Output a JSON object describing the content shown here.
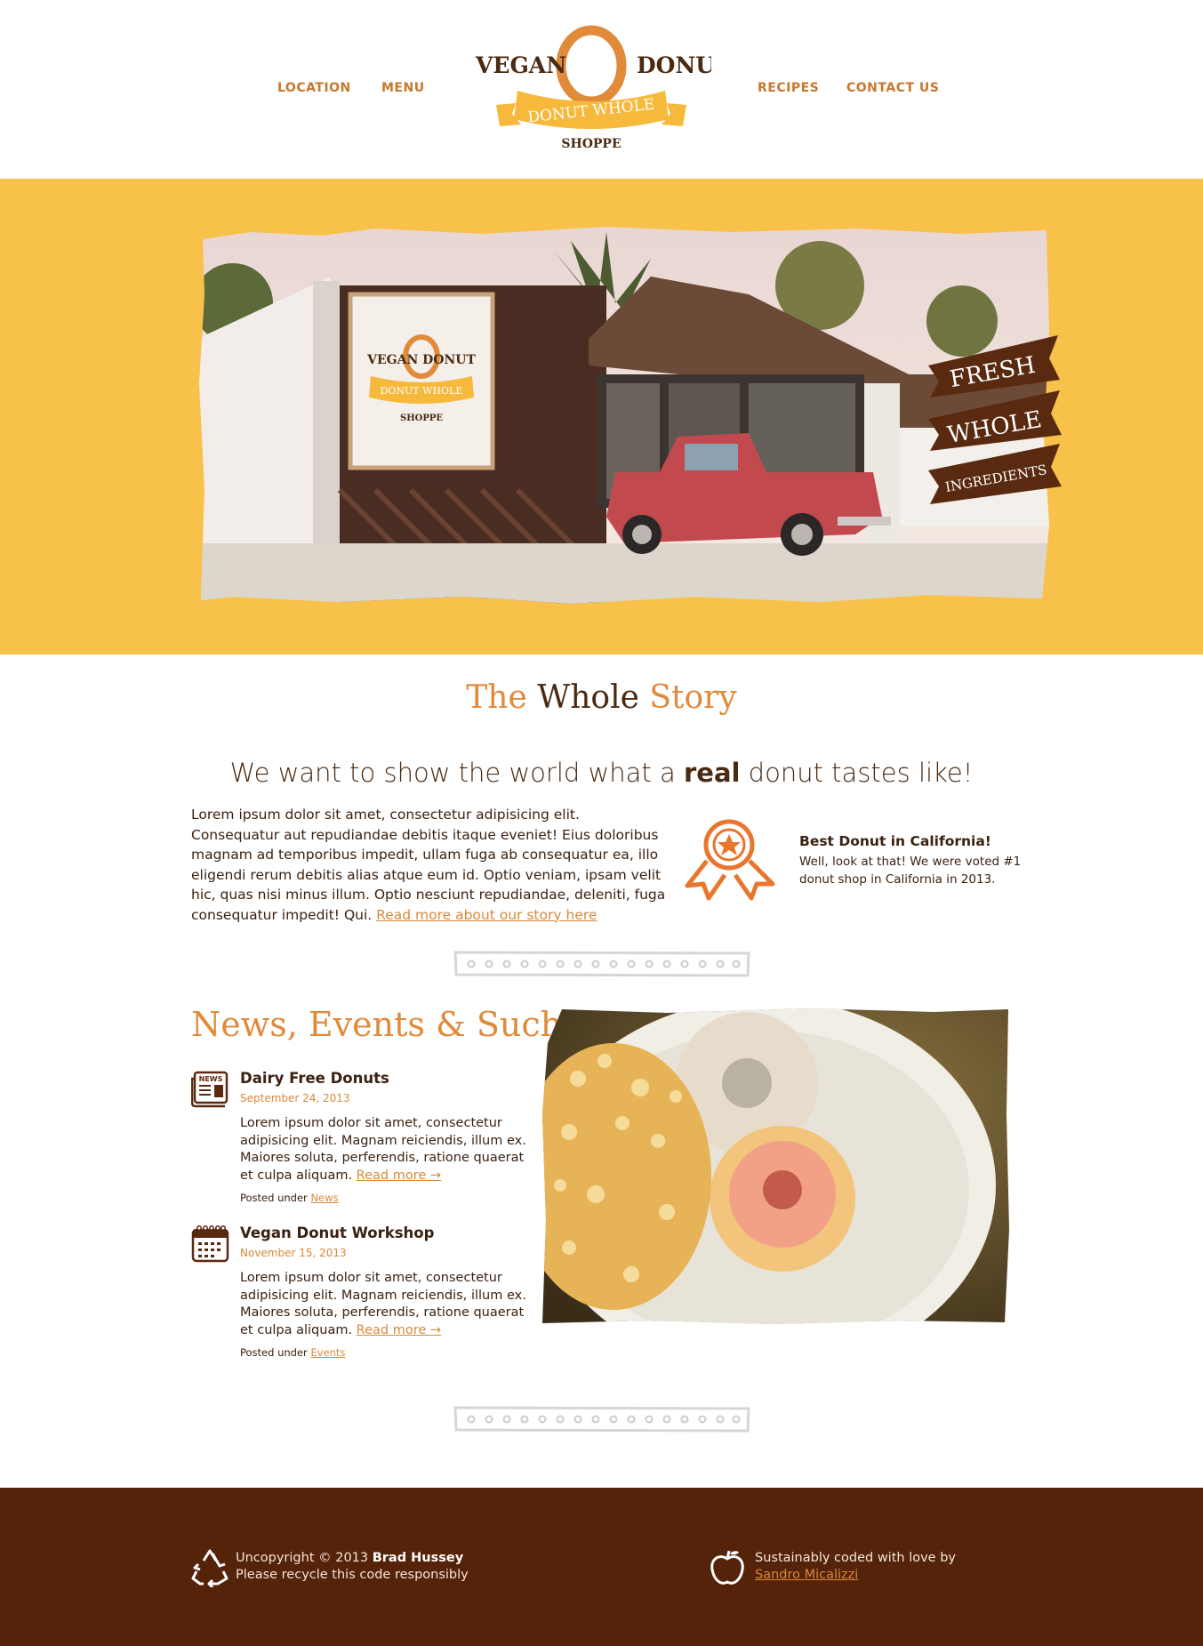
{
  "nav": {
    "location": "LOCATION",
    "menu": "MENU",
    "recipes": "RECIPES",
    "contact": "CONTACT US"
  },
  "logo": {
    "word1": "VEGAN",
    "word2": "DONUT",
    "banner": "DONUT WHOLE",
    "sub": "SHOPPE"
  },
  "hero": {
    "ribbon1": "FRESH",
    "ribbon2": "WHOLE",
    "ribbon3": "INGREDIENTS",
    "store_sign": "VEGAN DONUT",
    "store_banner": "DONUT WHOLE",
    "store_sub": "SHOPPE"
  },
  "story": {
    "title_part1": "The",
    "title_part2": "Whole",
    "title_part3": "Story",
    "tagline_pre": "We want to show the world what a ",
    "tagline_bold": "real",
    "tagline_post": " donut tastes like!",
    "body": "Lorem ipsum dolor sit amet, consectetur adipisicing elit. Consequatur aut repudiandae debitis itaque eveniet! Eius doloribus magnam ad temporibus impedit, ullam fuga ab consequatur ea, illo eligendi rerum debitis alias atque eum id. Optio veniam, ipsam velit hic, quas nisi minus illum. Optio nesciunt repudiandae, deleniti, fuga consequatur impedit! Qui. ",
    "read_more": "Read more about our story here",
    "award_title": "Best Donut in California!",
    "award_text": "Well, look at that! We were voted #1 donut shop in California in 2013."
  },
  "news": {
    "title": "News, Events & Such",
    "items": [
      {
        "title": "Dairy Free Donuts",
        "date": "September 24, 2013",
        "body": "Lorem ipsum dolor sit amet, consectetur adipisicing elit. Magnam reiciendis, illum ex. Maiores soluta, perferendis, ratione quaerat et culpa aliquam. ",
        "read_more": "Read more →",
        "posted_label": "Posted under ",
        "category": "News",
        "icon": "newspaper-icon"
      },
      {
        "title": "Vegan Donut Workshop",
        "date": "November 15, 2013",
        "body": "Lorem ipsum dolor sit amet, consectetur adipisicing elit. Magnam reiciendis, illum ex. Maiores soluta, perferendis, ratione quaerat et culpa aliquam. ",
        "read_more": "Read more →",
        "posted_label": "Posted under ",
        "category": "Events",
        "icon": "calendar-icon"
      }
    ]
  },
  "footer": {
    "copyright_pre": "Uncopyright © 2013 ",
    "copyright_name": "Brad Hussey",
    "recycle_line": "Please recycle this code responsibly",
    "coded_line": "Sustainably coded with love by",
    "coder_name": "Sandro Micalizzi"
  },
  "colors": {
    "accent": "#e08a3a",
    "nav": "#c8772b",
    "hero_bg": "#f8c14a",
    "brown": "#4a2a10",
    "footer_bg": "#55220a"
  }
}
